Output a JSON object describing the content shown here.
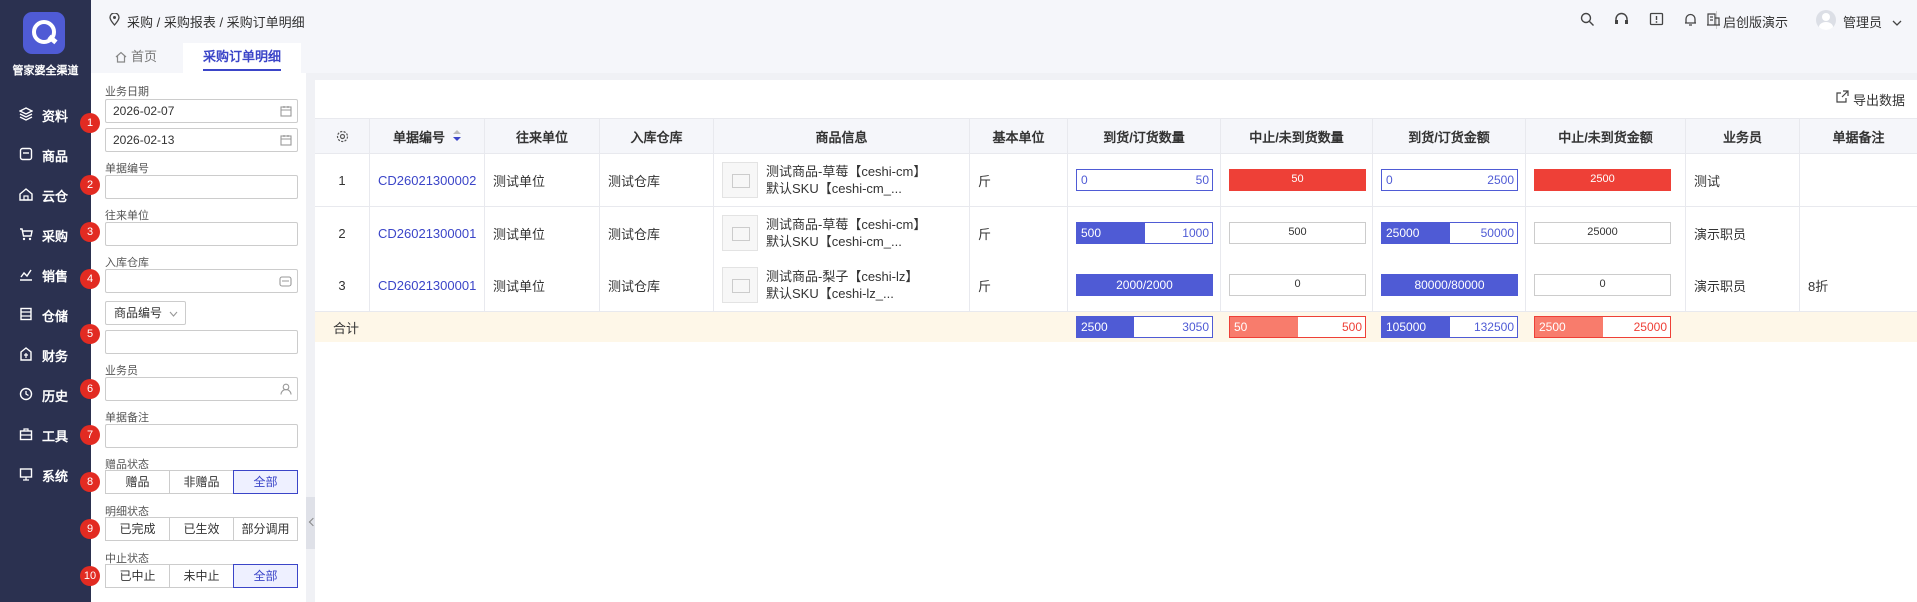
{
  "app": {
    "logo_text": "管家婆全渠道"
  },
  "nav": [
    {
      "label": "资料",
      "icon": "layers-icon"
    },
    {
      "label": "商品",
      "icon": "box-icon"
    },
    {
      "label": "云仓",
      "icon": "cloud-warehouse-icon"
    },
    {
      "label": "采购",
      "icon": "cart-icon"
    },
    {
      "label": "销售",
      "icon": "chart-icon"
    },
    {
      "label": "仓储",
      "icon": "storage-icon"
    },
    {
      "label": "财务",
      "icon": "finance-icon"
    },
    {
      "label": "历史",
      "icon": "history-icon"
    },
    {
      "label": "工具",
      "icon": "toolbox-icon"
    },
    {
      "label": "系统",
      "icon": "monitor-icon"
    }
  ],
  "header": {
    "breadcrumb": "采购 / 采购报表 / 采购订单明细",
    "tenant": "启创版演示",
    "user": "管理员"
  },
  "tabs": {
    "home": "首页",
    "active": "采购订单明细"
  },
  "filters": {
    "date_label": "业务日期",
    "date_start": "2026-02-07",
    "date_end": "2026-02-13",
    "bill_no_label": "单据编号",
    "partner_label": "往来单位",
    "warehouse_label": "入库仓库",
    "product_select": "商品编号",
    "staff_label": "业务员",
    "note_label": "单据备注",
    "gift_label": "赠品状态",
    "gift_options": [
      "赠品",
      "非赠品",
      "全部"
    ],
    "detail_label": "明细状态",
    "detail_options": [
      "已完成",
      "已生效",
      "部分调用"
    ],
    "stop_label": "中止状态",
    "stop_options": [
      "已中止",
      "未中止",
      "全部"
    ],
    "badges": [
      "1",
      "2",
      "3",
      "4",
      "5",
      "6",
      "7",
      "8",
      "9",
      "10"
    ]
  },
  "toolbar": {
    "export": "导出数据"
  },
  "table": {
    "headers": [
      "单据编号",
      "往来单位",
      "入库仓库",
      "商品信息",
      "基本单位",
      "到货/订货数量",
      "中止/未到货数量",
      "到货/订货金额",
      "中止/未到货金额",
      "业务员",
      "单据备注"
    ],
    "rows": [
      {
        "idx": "1",
        "bill_no": "CD26021300002",
        "partner": "测试单位",
        "warehouse": "测试仓库",
        "product_l1": "测试商品-草莓【ceshi-cm】",
        "product_l2": "默认SKU【ceshi-cm_...",
        "unit": "斤",
        "qty_l": "0",
        "qty_r": "50",
        "qty_fill": 0,
        "stop_qty": "50",
        "stop_qty_fill": 1,
        "amt_l": "0",
        "amt_r": "2500",
        "amt_fill": 0,
        "stop_amt": "2500",
        "stop_amt_fill": 1,
        "staff": "测试",
        "note": ""
      },
      {
        "idx": "2",
        "bill_no": "CD26021300001",
        "partner": "测试单位",
        "warehouse": "测试仓库",
        "product_l1": "测试商品-草莓【ceshi-cm】",
        "product_l2": "默认SKU【ceshi-cm_...",
        "unit": "斤",
        "qty_l": "500",
        "qty_r": "1000",
        "qty_fill": 0.5,
        "stop_qty": "500",
        "stop_qty_fill": 0,
        "amt_l": "25000",
        "amt_r": "50000",
        "amt_fill": 0.5,
        "stop_amt": "25000",
        "stop_amt_fill": 0,
        "staff": "演示职员",
        "note": ""
      },
      {
        "idx": "3",
        "bill_no": "CD26021300001",
        "partner": "测试单位",
        "warehouse": "测试仓库",
        "product_l1": "测试商品-梨子【ceshi-lz】",
        "product_l2": "默认SKU【ceshi-lz_...",
        "unit": "斤",
        "qty_c": "2000/2000",
        "qty_fill": 1,
        "stop_qty": "0",
        "stop_qty_fill": 0,
        "amt_c": "80000/80000",
        "amt_fill": 1,
        "stop_amt": "0",
        "stop_amt_fill": 0,
        "staff": "演示职员",
        "note": "8折"
      }
    ],
    "summary": {
      "label": "合计",
      "qty_l": "2500",
      "qty_r": "3050",
      "qty_fill": 0.42,
      "stop_qty_l": "50",
      "stop_qty_r": "500",
      "stop_qty_fill": 0.5,
      "amt_l": "105000",
      "amt_r": "132500",
      "amt_fill": 0.5,
      "stop_amt_l": "2500",
      "stop_amt_r": "25000",
      "stop_amt_fill": 0.5
    }
  },
  "colors": {
    "accent": "#4f5bd5",
    "danger": "#ee4037",
    "danger_light": "#f87c6c",
    "sidebar": "#2b3150",
    "summary_bg": "#fef7e8"
  }
}
